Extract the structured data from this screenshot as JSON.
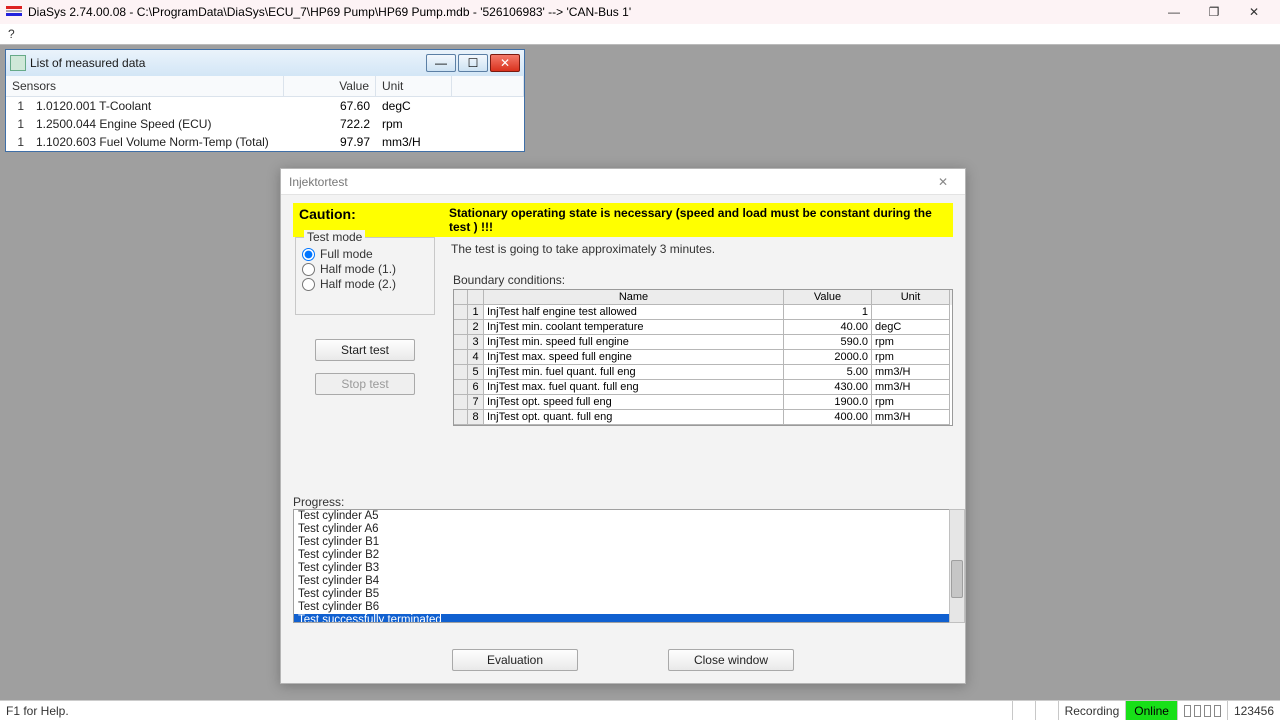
{
  "app": {
    "title": "DiaSys 2.74.00.08 - C:\\ProgramData\\DiaSys\\ECU_7\\HP69 Pump\\HP69 Pump.mdb - '526106983' --> 'CAN-Bus 1'",
    "help_menu": "?"
  },
  "measured": {
    "title": "List of measured data",
    "headers": {
      "sensors": "Sensors",
      "value": "Value",
      "unit": "Unit"
    },
    "rows": [
      {
        "idx": "1",
        "name": "1.0120.001 T-Coolant",
        "value": "67.60",
        "unit": "degC"
      },
      {
        "idx": "1",
        "name": "1.2500.044 Engine Speed (ECU)",
        "value": "722.2",
        "unit": "rpm"
      },
      {
        "idx": "1",
        "name": "1.1020.603 Fuel Volume Norm-Temp (Total)",
        "value": "97.97",
        "unit": "mm3/H"
      }
    ]
  },
  "dialog": {
    "title": "Injektortest",
    "caution_label": "Caution:",
    "caution_text": "Stationary operating state is necessary (speed and load must be constant during the test ) !!!",
    "info": "The test is going to take approximately 3 minutes.",
    "testmode": {
      "legend": "Test mode",
      "full": "Full mode",
      "half1": "Half mode (1.)",
      "half2": "Half mode (2.)"
    },
    "buttons": {
      "start": "Start test",
      "stop": "Stop test",
      "eval": "Evaluation",
      "close": "Close window"
    },
    "boundary_label": "Boundary conditions:",
    "boundary_headers": {
      "name": "Name",
      "value": "Value",
      "unit": "Unit"
    },
    "boundary_rows": [
      {
        "n": "1",
        "name": "InjTest half engine test allowed",
        "value": "1",
        "unit": ""
      },
      {
        "n": "2",
        "name": "InjTest min. coolant temperature",
        "value": "40.00",
        "unit": "degC"
      },
      {
        "n": "3",
        "name": "InjTest min. speed full engine",
        "value": "590.0",
        "unit": "rpm"
      },
      {
        "n": "4",
        "name": "InjTest max. speed full engine",
        "value": "2000.0",
        "unit": "rpm"
      },
      {
        "n": "5",
        "name": "InjTest min. fuel quant. full eng",
        "value": "5.00",
        "unit": "mm3/H"
      },
      {
        "n": "6",
        "name": "InjTest max. fuel quant. full eng",
        "value": "430.00",
        "unit": "mm3/H"
      },
      {
        "n": "7",
        "name": "InjTest opt. speed full eng",
        "value": "1900.0",
        "unit": "rpm"
      },
      {
        "n": "8",
        "name": "InjTest opt. quant. full eng",
        "value": "400.00",
        "unit": "mm3/H"
      }
    ],
    "progress_label": "Progress:",
    "progress": [
      {
        "t": "Test cylinder A5",
        "sel": false
      },
      {
        "t": "Test cylinder A6",
        "sel": false
      },
      {
        "t": "Test cylinder B1",
        "sel": false
      },
      {
        "t": "Test cylinder B2",
        "sel": false
      },
      {
        "t": "Test cylinder B3",
        "sel": false
      },
      {
        "t": "Test cylinder B4",
        "sel": false
      },
      {
        "t": "Test cylinder B5",
        "sel": false
      },
      {
        "t": "Test cylinder B6",
        "sel": false
      },
      {
        "t": "Test successfully terminated",
        "sel": true
      }
    ]
  },
  "status": {
    "help": "F1 for Help.",
    "recording": "Recording",
    "online": "Online",
    "counter": "123456"
  },
  "glyphs": {
    "min": "—",
    "max": "☐",
    "close": "✕",
    "restore": "❐"
  }
}
